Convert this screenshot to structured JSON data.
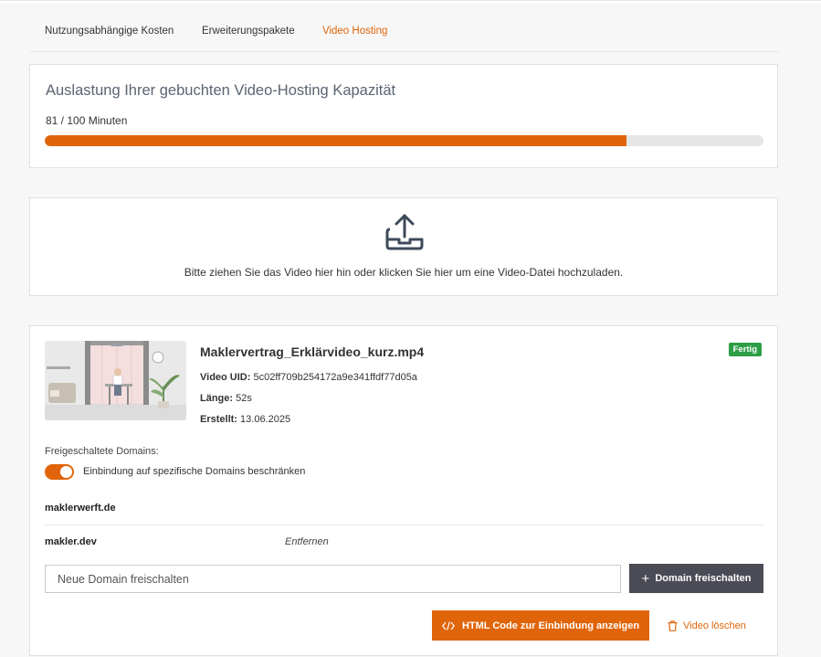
{
  "tabs": [
    {
      "label": "Nutzungsabhängige Kosten",
      "active": false
    },
    {
      "label": "Erweiterungspakete",
      "active": false
    },
    {
      "label": "Video Hosting",
      "active": true
    }
  ],
  "capacity": {
    "title": "Auslastung Ihrer gebuchten Video-Hosting Kapazität",
    "usage_text": "81 / 100 Minuten",
    "used_minutes": 81,
    "total_minutes": 100
  },
  "upload": {
    "icon": "upload-icon",
    "text": "Bitte ziehen Sie das Video hier hin oder klicken Sie hier um eine Video-Datei hochzuladen."
  },
  "video": {
    "filename": "Maklervertrag_Erklärvideo_kurz.mp4",
    "status": "Fertig",
    "uid_label": "Video UID:",
    "uid": "5c02ff709b254172a9e341ffdf77d05a",
    "length_label": "Länge:",
    "length": "52s",
    "created_label": "Erstellt:",
    "created": "13.06.2025"
  },
  "domains": {
    "label": "Freigeschaltete Domains:",
    "toggle_label": "Einbindung auf spezifische Domains beschränken",
    "toggle_on": true,
    "items": [
      {
        "name": "maklerwerft.de"
      },
      {
        "name": "makler.dev",
        "action": "Entfernen"
      }
    ],
    "input_placeholder": "Neue Domain freischalten",
    "add_button": "Domain freischalten"
  },
  "actions": {
    "embed_button": "HTML Code zur Einbindung anzeigen",
    "delete_button": "Video löschen"
  },
  "colors": {
    "accent": "#e0650a",
    "success": "#2e9e47",
    "dark_button": "#4b4b55"
  }
}
